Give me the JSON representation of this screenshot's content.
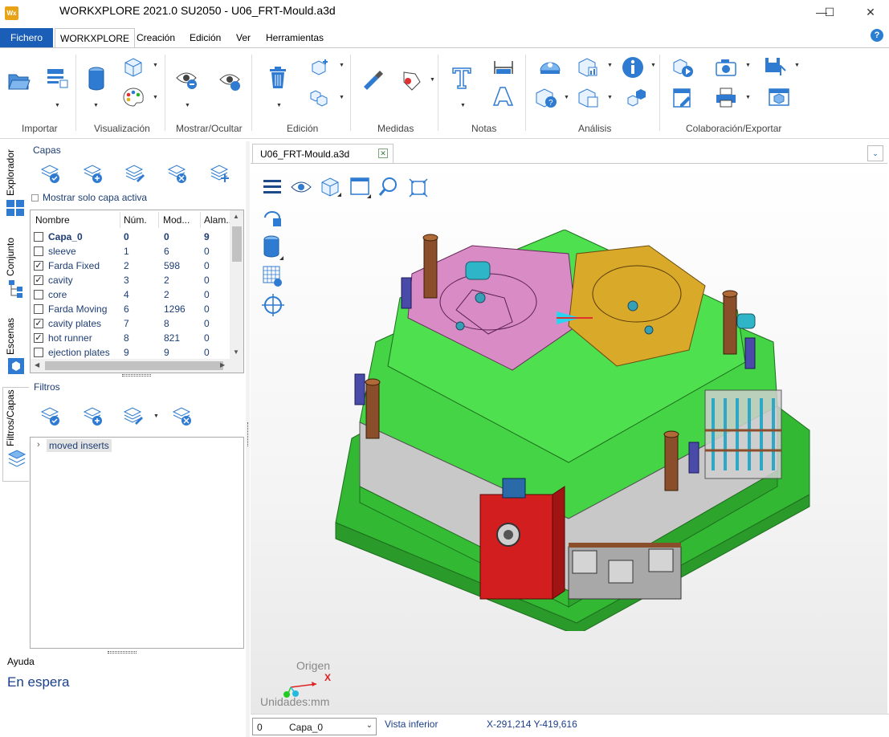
{
  "window": {
    "logo": "Wx",
    "title": "WORKXPLORE 2021.0 SU2050 - U06_FRT-Mould.a3d",
    "minimize": "—",
    "maximize": "☐",
    "close": "✕"
  },
  "menu_tabs": {
    "file": "Fichero",
    "items": [
      "WORKXPLORE",
      "Creación",
      "Edición",
      "Ver",
      "Herramientas"
    ],
    "help": "?"
  },
  "ribbon": {
    "groups": [
      "Importar",
      "Visualización",
      "Mostrar/Ocultar",
      "Edición",
      "Medidas",
      "Notas",
      "Análisis",
      "Colaboración/Exportar"
    ]
  },
  "side_tabs": [
    "Explorador",
    "Conjunto",
    "Escenas",
    "Filtros/Capas"
  ],
  "layers": {
    "title": "Capas",
    "show_active_only": "Mostrar solo capa activa",
    "columns": [
      "Nombre",
      "Núm.",
      "Mod...",
      "Alam..."
    ],
    "rows": [
      {
        "name": "Capa_0",
        "num": "0",
        "mod": "0",
        "alam": "9",
        "checked": false,
        "bold": true
      },
      {
        "name": "sleeve",
        "num": "1",
        "mod": "6",
        "alam": "0",
        "checked": false
      },
      {
        "name": "Farda Fixed",
        "num": "2",
        "mod": "598",
        "alam": "0",
        "checked": true
      },
      {
        "name": "cavity",
        "num": "3",
        "mod": "2",
        "alam": "0",
        "checked": true
      },
      {
        "name": "core",
        "num": "4",
        "mod": "2",
        "alam": "0",
        "checked": false
      },
      {
        "name": "Farda Moving",
        "num": "6",
        "mod": "1296",
        "alam": "0",
        "checked": false
      },
      {
        "name": "cavity plates",
        "num": "7",
        "mod": "8",
        "alam": "0",
        "checked": true
      },
      {
        "name": "hot runner",
        "num": "8",
        "mod": "821",
        "alam": "0",
        "checked": true
      },
      {
        "name": "ejection plates",
        "num": "9",
        "mod": "9",
        "alam": "0",
        "checked": false
      }
    ]
  },
  "filters": {
    "title": "Filtros",
    "items": [
      "moved inserts"
    ]
  },
  "help_panel": {
    "title": "Ayuda",
    "status": "En espera"
  },
  "document": {
    "tab_label": "U06_FRT-Mould.a3d",
    "origin_label": "Origen",
    "axis_x": "X",
    "units_label": "Unidades:mm"
  },
  "statusbar": {
    "layer_num": "0",
    "layer_name": "Capa_0",
    "view": "Vista inferior",
    "coords": "X-291,214 Y-419,616"
  },
  "colors": {
    "accent": "#1b5eb8",
    "mould_green": "#3fcf3f",
    "cavity_pink": "#d98bc6",
    "core_gold": "#d9a92a",
    "block_red": "#d21e1e"
  }
}
